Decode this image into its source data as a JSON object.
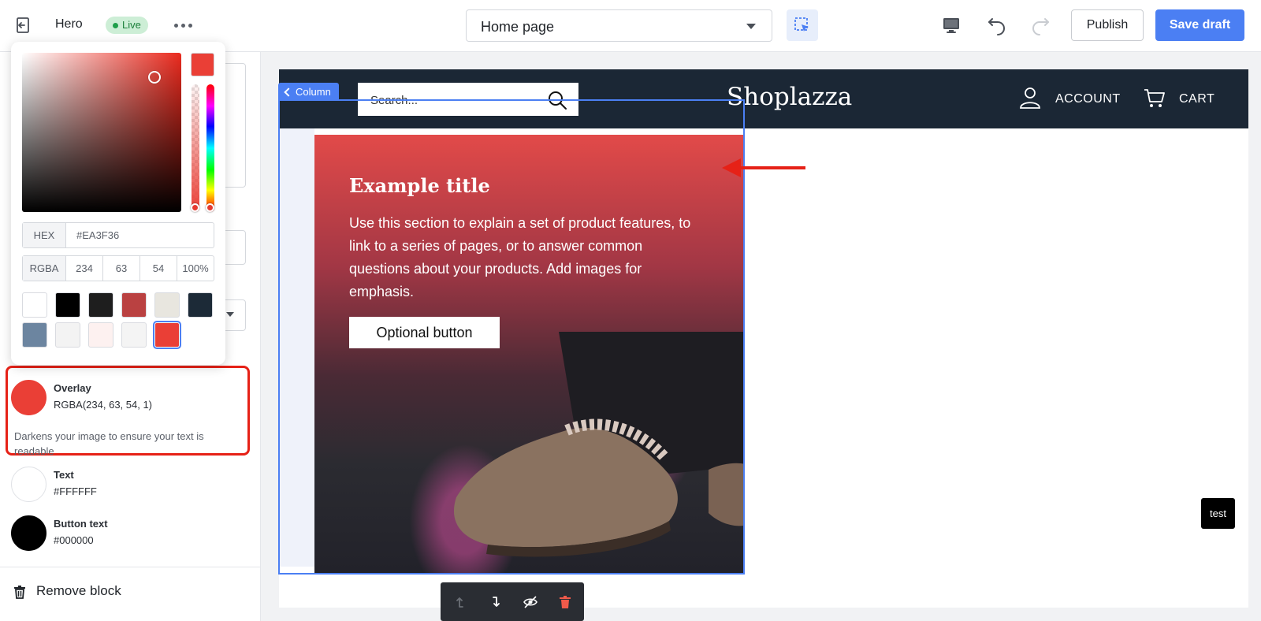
{
  "topbar": {
    "back_icon": "exit-icon",
    "section_name": "Hero",
    "status": "Live",
    "more_icon": "more-horizontal-icon",
    "page_select": "Home page",
    "select_tool_icon": "select-element-icon",
    "device_icon": "desktop-icon",
    "undo_icon": "undo-icon",
    "redo_icon": "redo-icon",
    "publish_label": "Publish",
    "save_label": "Save draft",
    "colors": {
      "primary": "#4b7ff3",
      "live_bg": "#cdeed6",
      "live_text": "#1b7f3a"
    }
  },
  "color_picker": {
    "current_color": "#EA3F36",
    "hex_label": "HEX",
    "hex_value": "#EA3F36",
    "rgba_label": "RGBA",
    "r": "234",
    "g": "63",
    "b": "54",
    "a": "100%",
    "presets": [
      "#FFFFFF",
      "#000000",
      "#1E1E1E",
      "#BA4141",
      "#E8E6DF",
      "#1C2A37",
      "#6C85A0",
      "#F3F3F3",
      "#FDF1F0",
      "#F4F4F4",
      "#EA3F36"
    ],
    "selected_preset": "#EA3F36"
  },
  "colors": [
    {
      "label": "Overlay",
      "value": "RGBA(234, 63, 54, 1)",
      "swatch": "#EA3F36",
      "help": "Darkens your image to ensure your text is readable"
    },
    {
      "label": "Text",
      "value": "#FFFFFF",
      "swatch": "#FFFFFF"
    },
    {
      "label": "Button text",
      "value": "#000000",
      "swatch": "#000000"
    }
  ],
  "remove_block": {
    "icon": "trash-icon",
    "label": "Remove block"
  },
  "store": {
    "search_placeholder": "Search...",
    "logo": "Shoplazza",
    "account": "ACCOUNT",
    "cart": "CART",
    "header_color": "#1b2735"
  },
  "column_tag": "Column",
  "hero": {
    "title": "Example title",
    "body": "Use this section to explain a set of product features, to link to a series of pages, or to answer common questions about your products. Add images for emphasis.",
    "button": "Optional button"
  },
  "test_badge": "test",
  "floating_toolbar": {
    "icons": [
      "move-up-icon",
      "move-down-icon",
      "hide-icon",
      "delete-icon"
    ]
  }
}
